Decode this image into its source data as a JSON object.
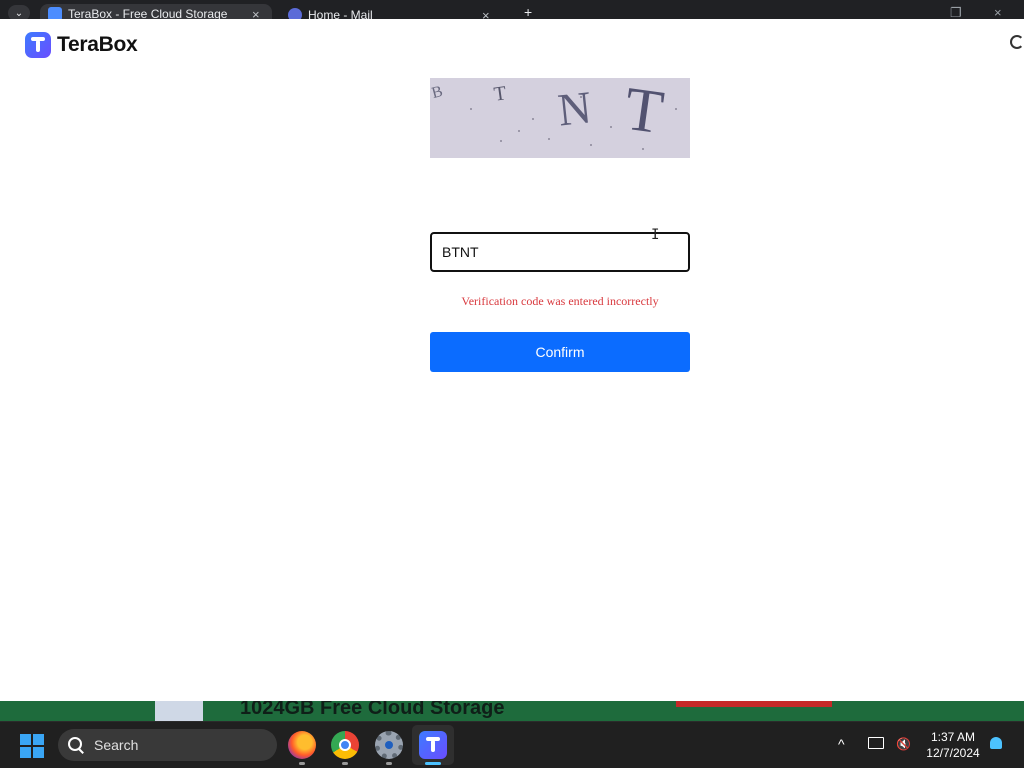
{
  "browser": {
    "tabs": [
      {
        "title": "TeraBox - Free Cloud Storage",
        "active": true
      },
      {
        "title": "Home - Mail",
        "active": false
      }
    ],
    "new_tab_symbol": "+",
    "close_symbol": "×"
  },
  "popup": {
    "brand_name": "TeraBox",
    "captcha_chars": [
      "B",
      "T",
      "N",
      "T"
    ],
    "input_value": "BTNT",
    "error_message": "Verification code was entered incorrectly",
    "confirm_label": "Confirm"
  },
  "background_page": {
    "banner_text": "1024GB Free Cloud Storage"
  },
  "taskbar": {
    "search_label": "Search",
    "time": "1:37 AM",
    "date": "12/7/2024",
    "chevron": "^"
  },
  "colors": {
    "accent": "#0b6cff",
    "error": "#d9393e",
    "captcha_bg": "#d4d0de"
  }
}
